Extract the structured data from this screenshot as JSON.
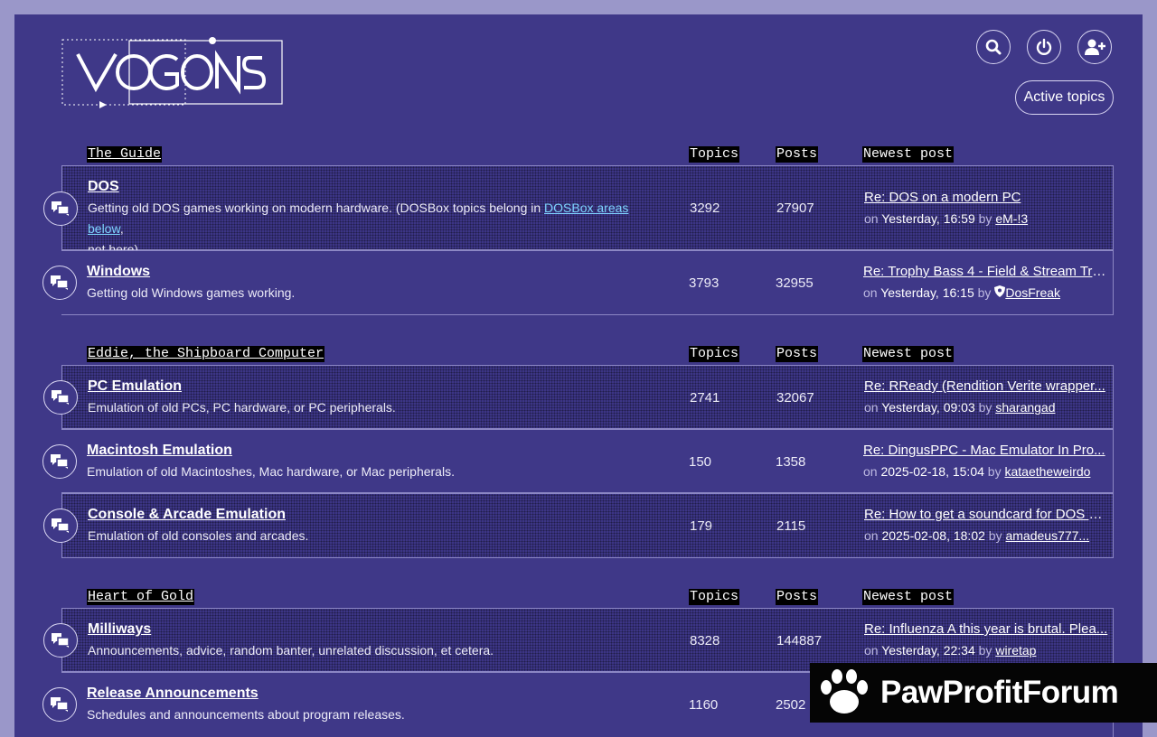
{
  "header": {
    "logo_text": "VOGONS",
    "active_topics_label": "Active topics",
    "icons": [
      "search-icon",
      "power-icon",
      "add-user-icon"
    ]
  },
  "columns": {
    "topics": "Topics",
    "posts": "Posts",
    "newest": "Newest post"
  },
  "categories": [
    {
      "title": "The Guide",
      "forums": [
        {
          "name": "DOS",
          "desc_prefix": "Getting old DOS games working on modern hardware. (DOSBox topics belong in ",
          "desc_link": "DOSBox areas below",
          "desc_suffix": ",",
          "desc_line2": "not here).",
          "topics": "3292",
          "posts": "27907",
          "newest_title": "Re: DOS on a modern PC",
          "on": "on",
          "when": "Yesterday, 16:59",
          "by": "by",
          "who": "eM-!3"
        },
        {
          "name": "Windows",
          "desc": "Getting old Windows games working.",
          "topics": "3793",
          "posts": "32955",
          "newest_title": "Re: Trophy Bass 4 - Field & Stream Tro...",
          "on": "on",
          "when": "Yesterday, 16:15",
          "by": "by",
          "who": "DosFreak"
        }
      ]
    },
    {
      "title": "Eddie, the Shipboard Computer",
      "forums": [
        {
          "name": "PC Emulation",
          "desc": "Emulation of old PCs, PC hardware, or PC peripherals.",
          "topics": "2741",
          "posts": "32067",
          "newest_title": "Re: RReady (Rendition Verite wrapper...",
          "on": "on",
          "when": "Yesterday, 09:03",
          "by": "by",
          "who": "sharangad"
        },
        {
          "name": "Macintosh Emulation",
          "desc": "Emulation of old Macintoshes, Mac hardware, or Mac peripherals.",
          "topics": "150",
          "posts": "1358",
          "newest_title": "Re: DingusPPC - Mac Emulator In Pro...",
          "on": "on",
          "when": "2025-02-18, 15:04",
          "by": "by",
          "who": "kataetheweirdo"
        },
        {
          "name": "Console & Arcade Emulation",
          "desc": "Emulation of old consoles and arcades.",
          "topics": "179",
          "posts": "2115",
          "newest_title": "Re: How to get a soundcard for DOS M...",
          "on": "on",
          "when": "2025-02-08, 18:02",
          "by": "by",
          "who": "amadeus777..."
        }
      ]
    },
    {
      "title": "Heart of Gold",
      "forums": [
        {
          "name": "Milliways",
          "desc": "Announcements, advice, random banter, unrelated discussion, et cetera.",
          "topics": "8328",
          "posts": "144887",
          "newest_title": "Re: Influenza A this year is brutal. Plea...",
          "on": "on",
          "when": "Yesterday, 22:34",
          "by": "by",
          "who": "wiretap"
        },
        {
          "name": "Release Announcements",
          "desc": "Schedules and announcements about program releases.",
          "topics": "1160",
          "posts": "2502"
        }
      ]
    }
  ],
  "watermark": {
    "text": "PawProfitForum"
  }
}
